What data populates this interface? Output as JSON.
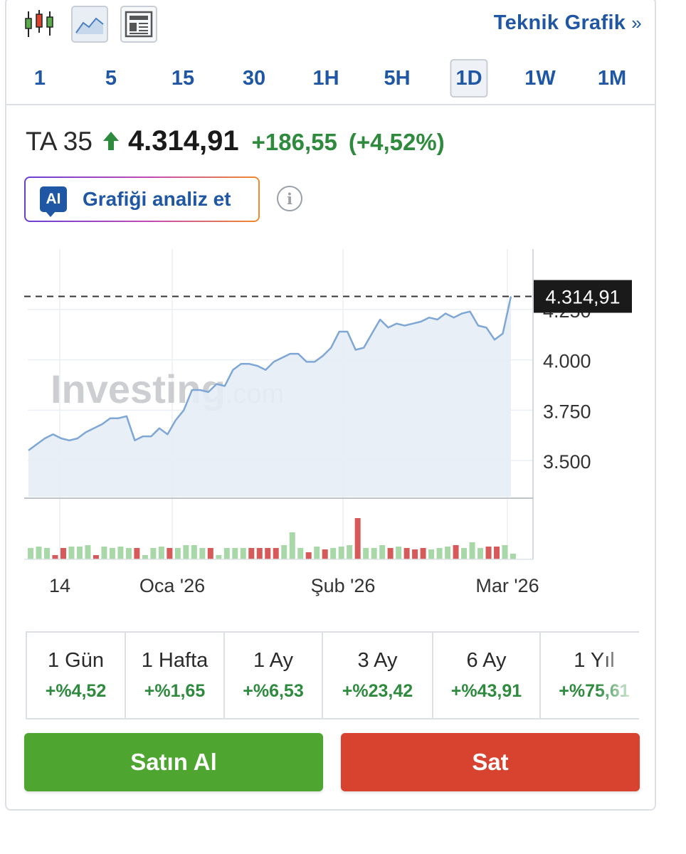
{
  "toolbar": {
    "technical_link": "Teknik Grafik",
    "technical_chevron": "»",
    "timeframes": [
      "1",
      "5",
      "15",
      "30",
      "1H",
      "5H",
      "1D",
      "1W",
      "1M"
    ],
    "active_timeframe": "1D"
  },
  "quote": {
    "name": "TA 35",
    "price": "4.314,91",
    "change": "+186,55",
    "change_pct": "(+4,52%)",
    "direction": "up"
  },
  "ai": {
    "badge": "AI",
    "label": "Grafiği analiz et",
    "info_glyph": "i"
  },
  "watermark": {
    "brand": "Investing",
    "suffix": ".com"
  },
  "chart_data": {
    "type": "area",
    "x_tick_labels": [
      "14",
      "Oca '26",
      "Şub '26",
      "Mar '26"
    ],
    "y_tick_labels": [
      "3.500",
      "3.750",
      "4.000",
      "4.250"
    ],
    "y_ticks": [
      3500,
      3750,
      4000,
      4250
    ],
    "last_price_label": "4.314,91",
    "last_price": 4314.91,
    "ylim": [
      3320,
      4550
    ],
    "series": [
      {
        "values": [
          3550,
          3580,
          3610,
          3630,
          3610,
          3600,
          3610,
          3640,
          3660,
          3680,
          3710,
          3710,
          3720,
          3600,
          3620,
          3620,
          3660,
          3630,
          3700,
          3750,
          3850,
          3850,
          3840,
          3880,
          3870,
          3950,
          3980,
          3980,
          3970,
          3950,
          3990,
          4010,
          4030,
          4030,
          3990,
          3990,
          4020,
          4060,
          4140,
          4140,
          4050,
          4060,
          4130,
          4200,
          4160,
          4180,
          4170,
          4180,
          4190,
          4210,
          4200,
          4230,
          4210,
          4230,
          4240,
          4170,
          4160,
          4100,
          4130,
          4314.91
        ],
        "volumes": [
          16,
          18,
          16,
          6,
          16,
          18,
          18,
          20,
          6,
          18,
          16,
          18,
          16,
          16,
          6,
          16,
          18,
          16,
          16,
          20,
          20,
          16,
          16,
          6,
          16,
          16,
          16,
          16,
          16,
          16,
          16,
          20,
          38,
          16,
          10,
          18,
          14,
          16,
          18,
          20,
          58,
          16,
          16,
          20,
          16,
          18,
          16,
          14,
          16,
          14,
          16,
          18,
          20,
          16,
          24,
          16,
          18,
          18,
          20,
          8
        ],
        "volume_up": [
          1,
          1,
          1,
          0,
          0,
          1,
          1,
          1,
          0,
          1,
          1,
          1,
          1,
          0,
          1,
          1,
          1,
          0,
          1,
          1,
          1,
          1,
          0,
          1,
          1,
          1,
          1,
          0,
          0,
          0,
          0,
          1,
          1,
          1,
          0,
          1,
          0,
          1,
          1,
          1,
          0,
          1,
          1,
          1,
          0,
          1,
          0,
          0,
          0,
          1,
          1,
          1,
          0,
          1,
          1,
          1,
          0,
          0,
          1,
          1
        ]
      }
    ],
    "grid": true
  },
  "periods": [
    {
      "label": "1 Gün",
      "value": "+%4,52"
    },
    {
      "label": "1 Hafta",
      "value": "+%1,65"
    },
    {
      "label": "1 Ay",
      "value": "+%6,53"
    },
    {
      "label": "3 Ay",
      "value": "+%23,42"
    },
    {
      "label": "6 Ay",
      "value": "+%43,91"
    },
    {
      "label": "1 Yıl",
      "value": "+%75,61"
    }
  ],
  "actions": {
    "buy": "Satın Al",
    "sell": "Sat"
  },
  "colors": {
    "link": "#1f57a4",
    "positive": "#2e8b3e",
    "buy": "#4ea52f",
    "sell": "#d8432f",
    "line": "#7fa7d6",
    "area": "#e6edf6",
    "volume_up": "#a8d8a8",
    "volume_down": "#d65a5a"
  }
}
